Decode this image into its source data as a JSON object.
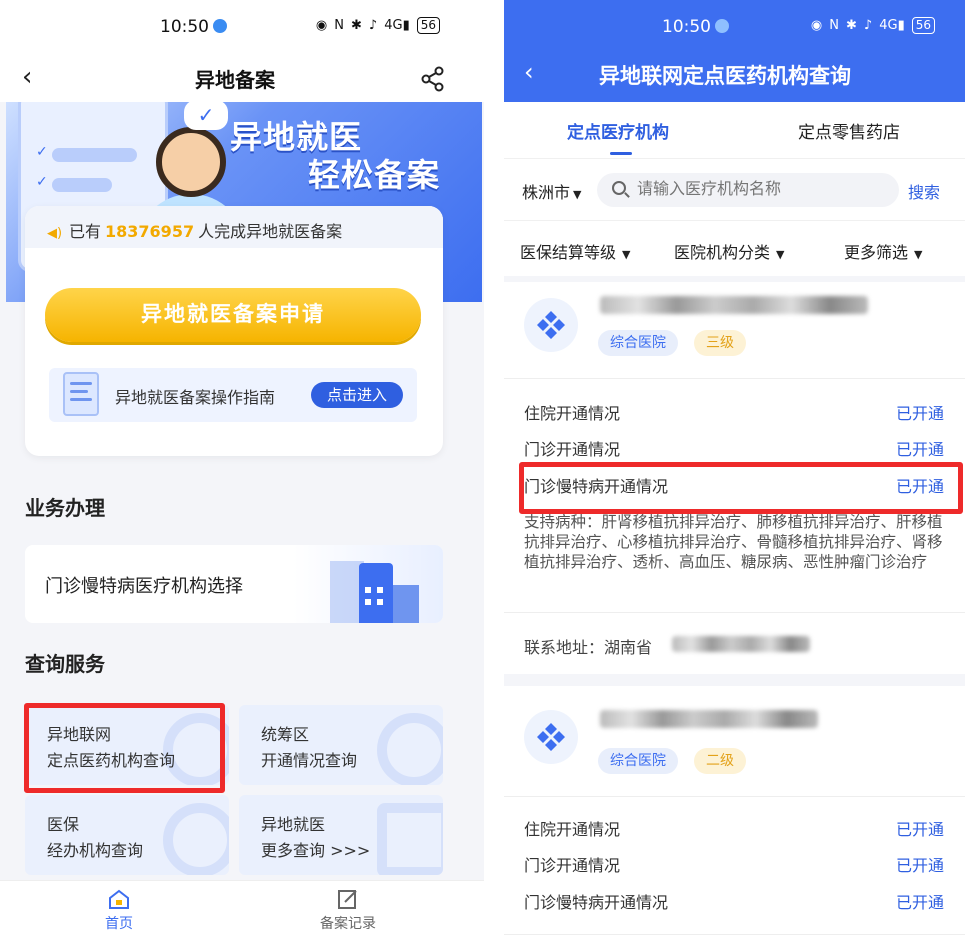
{
  "status": {
    "time": "10:50",
    "net": "4G",
    "battery": "56"
  },
  "left": {
    "nav_title": "异地备案",
    "banner": {
      "line1": "异地就医",
      "line2": "轻松备案"
    },
    "count": {
      "prefix": "已有",
      "number": "18376957",
      "suffix": "人完成异地就医备案"
    },
    "apply_label": "异地就医备案申请",
    "guide": {
      "text": "异地就医备案操作指南",
      "button": "点击进入"
    },
    "business_title": "业务办理",
    "outpatient_select": "门诊慢特病医疗机构选择",
    "query_title": "查询服务",
    "query_items": [
      {
        "line1": "异地联网",
        "line2": "定点医药机构查询"
      },
      {
        "line1": "统筹区",
        "line2": "开通情况查询"
      },
      {
        "line1": "医保",
        "line2": "经办机构查询"
      },
      {
        "line1": "异地就医",
        "line2": "更多查询 >>>"
      }
    ],
    "tabs": [
      {
        "label": "首页"
      },
      {
        "label": "备案记录"
      }
    ]
  },
  "right": {
    "nav_title": "异地联网定点医药机构查询",
    "tabs": [
      "定点医疗机构",
      "定点零售药店"
    ],
    "city": "株洲市",
    "search_placeholder": "请输入医疗机构名称",
    "search_button": "搜索",
    "filters": [
      "医保结算等级",
      "医院机构分类",
      "更多筛选"
    ],
    "hospitals": [
      {
        "tags": [
          "综合医院",
          "三级"
        ],
        "rows": [
          {
            "label": "住院开通情况",
            "value": "已开通"
          },
          {
            "label": "门诊开通情况",
            "value": "已开通"
          },
          {
            "label": "门诊慢特病开通情况",
            "value": "已开通"
          }
        ],
        "diseases": "支持病种：肝肾移植抗排异治疗、肺移植抗排异治疗、肝移植抗排异治疗、心移植抗排异治疗、骨髓移植抗排异治疗、肾移植抗排异治疗、透析、高血压、糖尿病、恶性肿瘤门诊治疗",
        "address_label": "联系地址：",
        "address_value": "湖南省"
      },
      {
        "tags": [
          "综合医院",
          "二级"
        ],
        "rows": [
          {
            "label": "住院开通情况",
            "value": "已开通"
          },
          {
            "label": "门诊开通情况",
            "value": "已开通"
          },
          {
            "label": "门诊慢特病开通情况",
            "value": "已开通"
          }
        ]
      }
    ]
  },
  "colors": {
    "primary": "#3d6ef0",
    "accent": "#f6b400",
    "highlight": "#ee2a2a"
  }
}
